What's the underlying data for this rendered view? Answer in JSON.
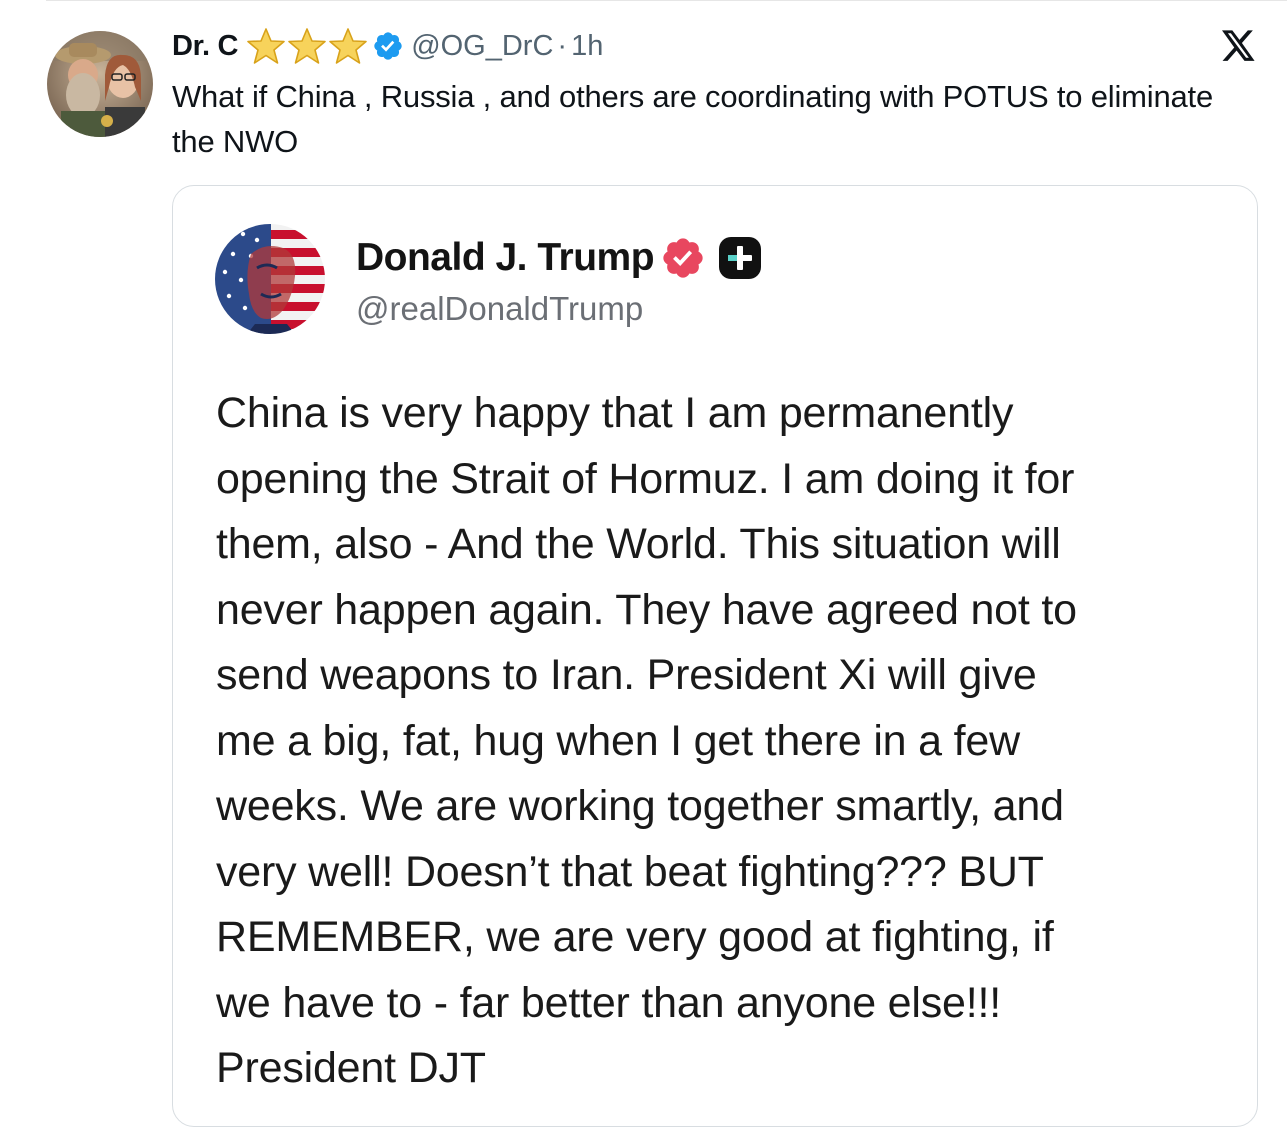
{
  "tweet": {
    "display_name": "Dr. C",
    "star_count": 3,
    "verified": true,
    "handle": "@OG_DrC",
    "separator": "·",
    "time": "1h",
    "text": "What if China , Russia , and others are coordinating with POTUS to eliminate the NWO",
    "avatar_icon": "profile-photo",
    "platform_icon": "x-logo-icon"
  },
  "quoted_post": {
    "author_name": "Donald J. Trump",
    "author_handle": "@realDonaldTrump",
    "verified_color": "#e8475f",
    "avatar_icon": "flag-portrait-avatar",
    "badge_icon": "plus-badge-icon",
    "body_lines": [
      "China is very happy that I am permanently",
      "opening the Strait of Hormuz. I am doing it for",
      "them, also - And the World. This situation will",
      "never happen again. They have agreed not to",
      "send weapons to Iran. President Xi will give",
      "me a big, fat, hug when I get there in a few",
      "weeks. We are working together smartly, and",
      "very well! Doesn’t that beat fighting??? BUT",
      "REMEMBER, we are very good at fighting, if",
      "we have to - far better than anyone else!!!",
      "President DJT"
    ]
  },
  "colors": {
    "text_primary": "#0f1419",
    "text_secondary": "#536471",
    "verified_blue": "#1d9bf0",
    "star_gold": "#f5c518",
    "card_border": "#d8dde1"
  }
}
